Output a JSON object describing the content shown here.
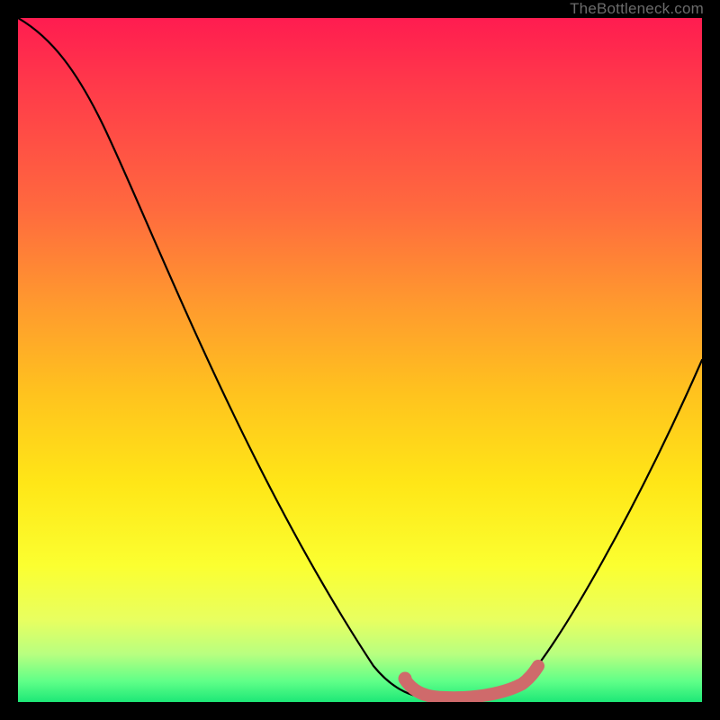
{
  "watermark": {
    "text": "TheBottleneck.com"
  },
  "chart_data": {
    "type": "line",
    "title": "",
    "xlabel": "",
    "ylabel": "",
    "xlim": [
      0,
      100
    ],
    "ylim": [
      0,
      100
    ],
    "series": [
      {
        "name": "bottleneck-curve",
        "x": [
          0,
          6,
          12,
          18,
          24,
          30,
          36,
          42,
          48,
          54,
          58,
          62,
          66,
          70,
          74,
          78,
          82,
          86,
          90,
          94,
          98,
          100
        ],
        "values": [
          100,
          96,
          87,
          77,
          67,
          57,
          47,
          37,
          27,
          17,
          10,
          4,
          1,
          1,
          1,
          3,
          8,
          15,
          24,
          34,
          44,
          50
        ]
      },
      {
        "name": "optimal-range-marker",
        "x": [
          58,
          62,
          66,
          70,
          74,
          76
        ],
        "values": [
          4,
          1,
          1,
          1,
          1,
          3
        ]
      }
    ],
    "colors": {
      "curve": "#000000",
      "marker": "#cf6a6b",
      "gradient_stops": [
        "#ff1c50",
        "#ff9a2e",
        "#ffe617",
        "#1de877"
      ]
    }
  }
}
